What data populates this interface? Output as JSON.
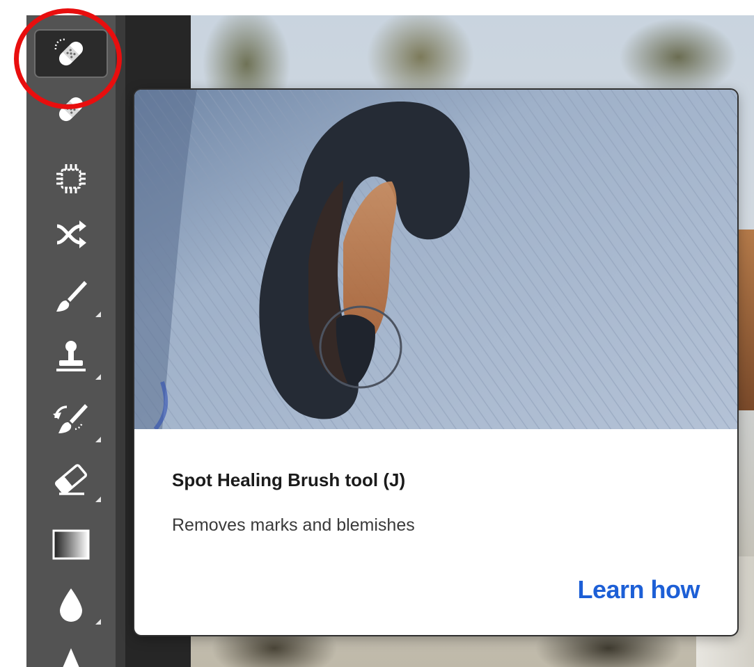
{
  "tooltip": {
    "title": "Spot Healing Brush tool (J)",
    "description": "Removes marks and blemishes",
    "link_label": "Learn how",
    "link_color": "#1d5fd6"
  },
  "toolbar": {
    "background": "#535353",
    "active_tool": "spot-healing-brush",
    "tools": [
      {
        "id": "spot-healing-brush",
        "icon": "spot-healing-brush-icon",
        "active": true,
        "has_submenu": false
      },
      {
        "id": "healing-brush",
        "icon": "healing-brush-icon",
        "active": false,
        "has_submenu": false
      },
      {
        "id": "patch",
        "icon": "patch-icon",
        "active": false,
        "has_submenu": false
      },
      {
        "id": "content-aware-move",
        "icon": "content-aware-move-icon",
        "active": false,
        "has_submenu": false
      },
      {
        "id": "brush",
        "icon": "brush-icon",
        "active": false,
        "has_submenu": true
      },
      {
        "id": "clone-stamp",
        "icon": "clone-stamp-icon",
        "active": false,
        "has_submenu": true
      },
      {
        "id": "history-brush",
        "icon": "history-brush-icon",
        "active": false,
        "has_submenu": true
      },
      {
        "id": "eraser",
        "icon": "eraser-icon",
        "active": false,
        "has_submenu": true
      },
      {
        "id": "gradient",
        "icon": "gradient-icon",
        "active": false,
        "has_submenu": false
      },
      {
        "id": "blur",
        "icon": "blur-drop-icon",
        "active": false,
        "has_submenu": true
      },
      {
        "id": "dodge",
        "icon": "dodge-icon",
        "active": false,
        "has_submenu": false
      }
    ]
  },
  "annotation": {
    "highlight_color": "#e80e0e"
  }
}
